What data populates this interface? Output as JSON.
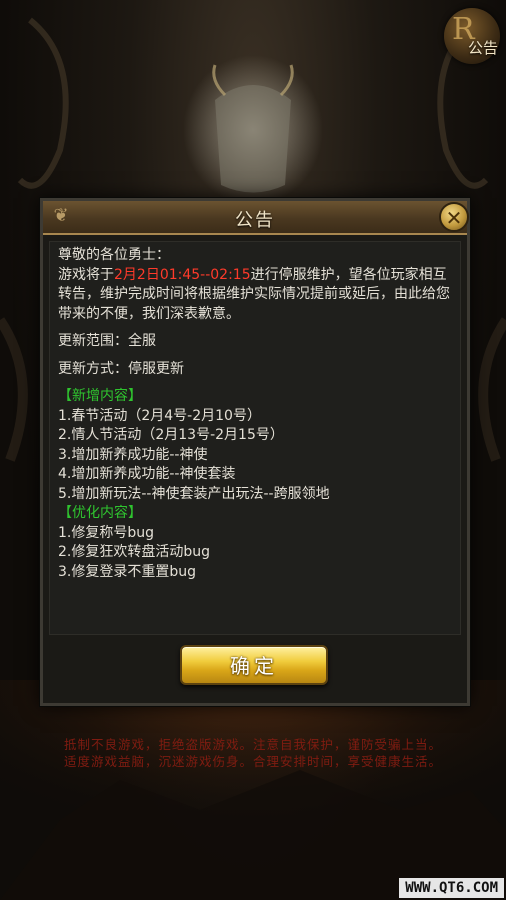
{
  "corner_notice": {
    "glyph": "R",
    "label": "公告"
  },
  "dialog": {
    "title": "公告",
    "greeting": "尊敬的各位勇士：",
    "intro_before": "游戏将于",
    "intro_time": "2月2日01:45--02:15",
    "intro_after": "进行停服维护，望各位玩家相互转告，维护完成时间将根据维护实际情况提前或延后，由此给您带来的不便，我们深表歉意。",
    "scope_line": "更新范围：全服",
    "method_line": "更新方式：停服更新",
    "new_header": "【新增内容】",
    "new_items": [
      "1.春节活动（2月4号-2月10号）",
      "2.情人节活动（2月13号-2月15号）",
      "3.增加新养成功能--神使",
      "4.增加新养成功能--神使套装",
      "5.增加新玩法--神使套装产出玩法--跨服领地"
    ],
    "opt_header": "【优化内容】",
    "opt_items": [
      "1.修复称号bug",
      "2.修复狂欢转盘活动bug",
      "3.修复登录不重置bug"
    ],
    "confirm_label": "确定"
  },
  "footer": {
    "line1": "抵制不良游戏，拒绝盗版游戏。注意自我保护，谨防受骗上当。",
    "line2": "适度游戏益脑，沉迷游戏伤身。合理安排时间，享受健康生活。"
  },
  "watermark": "WWW.QT6.COM",
  "colors": {
    "highlight_red": "#ff3a2a",
    "section_green": "#2fc42f",
    "button_gold": "#f0cc3c"
  }
}
